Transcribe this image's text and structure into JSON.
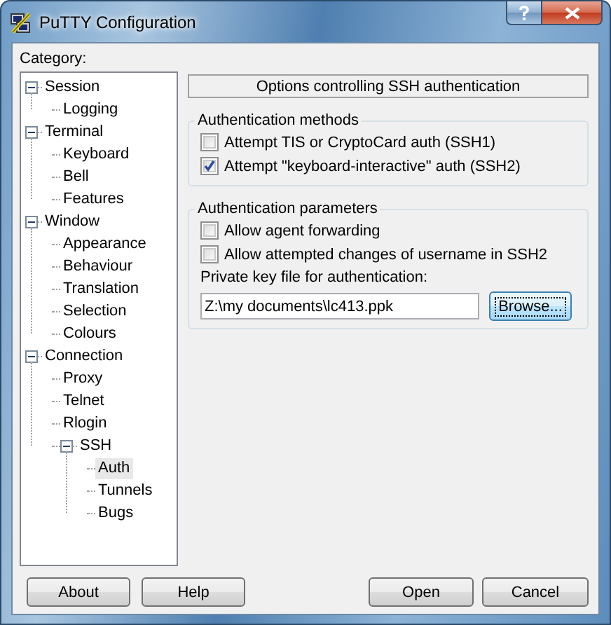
{
  "window": {
    "title": "PuTTY Configuration"
  },
  "category_label": "Category:",
  "tree": [
    {
      "label": "Session",
      "expanded": true,
      "selected": false,
      "children": [
        {
          "label": "Logging",
          "selected": false
        }
      ]
    },
    {
      "label": "Terminal",
      "expanded": true,
      "selected": false,
      "children": [
        {
          "label": "Keyboard",
          "selected": false
        },
        {
          "label": "Bell",
          "selected": false
        },
        {
          "label": "Features",
          "selected": false
        }
      ]
    },
    {
      "label": "Window",
      "expanded": true,
      "selected": false,
      "children": [
        {
          "label": "Appearance",
          "selected": false
        },
        {
          "label": "Behaviour",
          "selected": false
        },
        {
          "label": "Translation",
          "selected": false
        },
        {
          "label": "Selection",
          "selected": false
        },
        {
          "label": "Colours",
          "selected": false
        }
      ]
    },
    {
      "label": "Connection",
      "expanded": true,
      "selected": false,
      "children": [
        {
          "label": "Proxy",
          "selected": false
        },
        {
          "label": "Telnet",
          "selected": false
        },
        {
          "label": "Rlogin",
          "selected": false
        },
        {
          "label": "SSH",
          "expanded": true,
          "selected": false,
          "children": [
            {
              "label": "Auth",
              "selected": true
            },
            {
              "label": "Tunnels",
              "selected": false
            },
            {
              "label": "Bugs",
              "selected": false
            }
          ]
        }
      ]
    }
  ],
  "panel": {
    "header": "Options controlling SSH authentication",
    "groups": [
      {
        "title": "Authentication methods",
        "items": [
          {
            "kind": "checkbox",
            "label": "Attempt TIS or CryptoCard auth (SSH1)",
            "checked": false
          },
          {
            "kind": "checkbox",
            "label": "Attempt \"keyboard-interactive\" auth (SSH2)",
            "checked": true
          }
        ]
      },
      {
        "title": "Authentication parameters",
        "items": [
          {
            "kind": "checkbox",
            "label": "Allow agent forwarding",
            "checked": false
          },
          {
            "kind": "checkbox",
            "label": "Allow attempted changes of username in SSH2",
            "checked": false
          },
          {
            "kind": "file",
            "label": "Private key file for authentication:",
            "value": "Z:\\my documents\\lc413.ppk",
            "button": "Browse...",
            "focused": true
          }
        ]
      }
    ]
  },
  "left_buttons": [
    "About",
    "Help"
  ],
  "right_buttons": [
    "Open",
    "Cancel"
  ]
}
